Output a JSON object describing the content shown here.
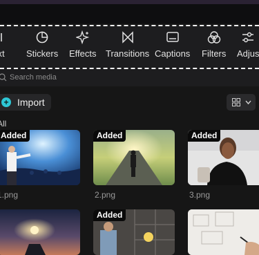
{
  "toolbar": {
    "items": [
      {
        "label": "ext",
        "icon": "text-icon"
      },
      {
        "label": "Stickers",
        "icon": "sticker-icon"
      },
      {
        "label": "Effects",
        "icon": "effects-sparkle-icon"
      },
      {
        "label": "Transitions",
        "icon": "transition-bowtie-icon"
      },
      {
        "label": "Captions",
        "icon": "captions-icon"
      },
      {
        "label": "Filters",
        "icon": "filters-circles-icon"
      },
      {
        "label": "Adjus",
        "icon": "adjust-sliders-icon"
      }
    ]
  },
  "search": {
    "placeholder": "Search media"
  },
  "import": {
    "label": "Import"
  },
  "section": {
    "label": "All"
  },
  "media": [
    {
      "badge": "Added",
      "name": "1.png"
    },
    {
      "badge": "Added",
      "name": "2.png"
    },
    {
      "badge": "Added",
      "name": "3.png"
    },
    {
      "badge": "",
      "name": ""
    },
    {
      "badge": "Added",
      "name": ""
    },
    {
      "badge": "",
      "name": ""
    }
  ],
  "colors": {
    "accent": "#2ec7d6",
    "background": "#161616",
    "panel": "#1d1d1f"
  }
}
